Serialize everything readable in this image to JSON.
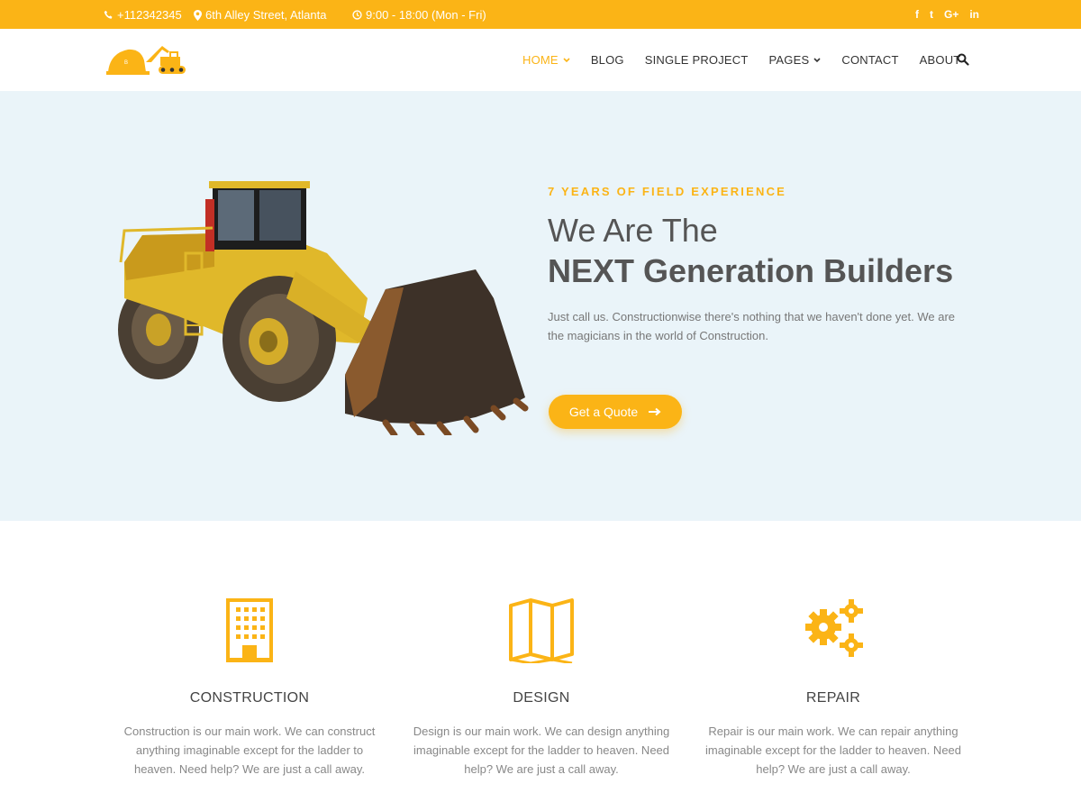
{
  "topbar": {
    "phone": "+112342345",
    "address": "6th Alley Street, Atlanta",
    "hours": "9:00 - 18:00 (Mon - Fri)",
    "social": [
      {
        "icon": "facebook-icon",
        "glyph": "f"
      },
      {
        "icon": "twitter-icon",
        "glyph": "t"
      },
      {
        "icon": "google-plus-icon",
        "glyph": "G+"
      },
      {
        "icon": "linkedin-icon",
        "glyph": "in"
      }
    ]
  },
  "nav": {
    "items": [
      {
        "label": "HOME",
        "active": true,
        "dropdown": true
      },
      {
        "label": "BLOG",
        "active": false,
        "dropdown": false
      },
      {
        "label": "SINGLE PROJECT",
        "active": false,
        "dropdown": false
      },
      {
        "label": "PAGES",
        "active": false,
        "dropdown": true
      },
      {
        "label": "CONTACT",
        "active": false,
        "dropdown": false
      },
      {
        "label": "ABOUT",
        "active": false,
        "dropdown": false
      }
    ]
  },
  "hero": {
    "eyebrow": "7 YEARS OF FIELD EXPERIENCE",
    "headline_light": "We Are The",
    "headline_bold": "NEXT Generation Builders",
    "text": "Just call us. Constructionwise there's nothing that we haven't done yet. We are the magicians in the world of Construction.",
    "cta_label": "Get a Quote"
  },
  "services": [
    {
      "title": "CONSTRUCTION",
      "icon": "building-icon",
      "text": "Construction is our main work. We can construct anything imaginable except for the ladder to heaven. Need help? We are just a call away."
    },
    {
      "title": "DESIGN",
      "icon": "map-icon",
      "text": "Design is our main work. We can design anything imaginable except for the ladder to heaven. Need help? We are just a call away."
    },
    {
      "title": "REPAIR",
      "icon": "gears-icon",
      "text": "Repair is our main work. We can repair anything imaginable except for the ladder to heaven. Need help? We are just a call away."
    }
  ],
  "colors": {
    "accent": "#fbb416",
    "hero_bg": "#eaf4f9",
    "heading": "#555555",
    "body_text": "#888888"
  }
}
